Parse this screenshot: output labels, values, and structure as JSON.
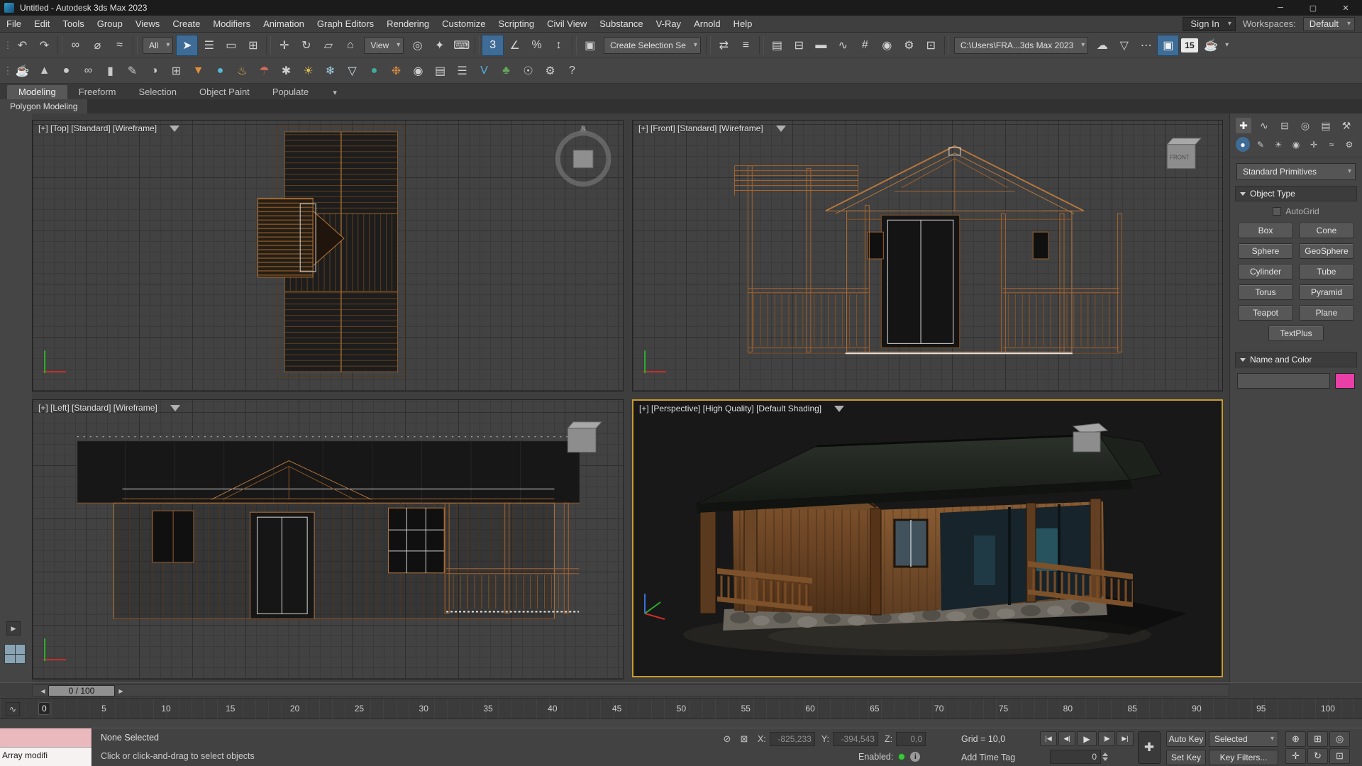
{
  "window": {
    "title": "Untitled - Autodesk 3ds Max 2023",
    "controls": [
      {
        "name": "minimize-button",
        "label": "─"
      },
      {
        "name": "maximize-button",
        "label": "▢"
      },
      {
        "name": "close-button",
        "label": "✕"
      }
    ]
  },
  "menubar": {
    "items": [
      "File",
      "Edit",
      "Tools",
      "Group",
      "Views",
      "Create",
      "Modifiers",
      "Animation",
      "Graph Editors",
      "Rendering",
      "Customize",
      "Scripting",
      "Civil View",
      "Substance",
      "V-Ray",
      "Arnold",
      "Help"
    ],
    "sign_in": "Sign In",
    "workspaces_label": "Workspaces:",
    "workspace_value": "Default"
  },
  "toolbar_main": {
    "items": [
      {
        "name": "toolbar-grip",
        "label": "⋮",
        "cls": "grip"
      },
      {
        "name": "undo-icon",
        "label": "↶"
      },
      {
        "name": "redo-icon",
        "label": "↷"
      },
      {
        "name": "separator",
        "label": "",
        "cls": "sep"
      },
      {
        "name": "select-and-link-icon",
        "label": "∞"
      },
      {
        "name": "unlink-selection-icon",
        "label": "⌀"
      },
      {
        "name": "bind-to-space-warp-icon",
        "label": "≈"
      },
      {
        "name": "separator",
        "label": "",
        "cls": "sep"
      },
      {
        "name": "selection-filter-dropdown",
        "label": "All",
        "cls": "dd"
      },
      {
        "name": "select-object-icon",
        "label": "➤",
        "cls": "active"
      },
      {
        "name": "select-by-name-icon",
        "label": "☰"
      },
      {
        "name": "rectangular-selection-region-icon",
        "label": "▭"
      },
      {
        "name": "window-crossing-icon",
        "label": "⊞"
      },
      {
        "name": "separator",
        "label": "",
        "cls": "sep"
      },
      {
        "name": "select-and-move-icon",
        "label": "✛"
      },
      {
        "name": "select-and-rotate-icon",
        "label": "↻"
      },
      {
        "name": "select-and-scale-icon",
        "label": "▱"
      },
      {
        "name": "select-and-place-icon",
        "label": "⌂"
      },
      {
        "name": "reference-coordinate-dropdown",
        "label": "View",
        "cls": "dd"
      },
      {
        "name": "use-pivot-center-icon",
        "label": "◎"
      },
      {
        "name": "select-and-manipulate-icon",
        "label": "✦"
      },
      {
        "name": "keyboard-shortcut-override-icon",
        "label": "⌨"
      },
      {
        "name": "separator",
        "label": "",
        "cls": "sep"
      },
      {
        "name": "snaps-toggle-icon",
        "label": "3",
        "cls": "active"
      },
      {
        "name": "angle-snap-icon",
        "label": "∠"
      },
      {
        "name": "percent-snap-icon",
        "label": "%"
      },
      {
        "name": "spinner-snap-icon",
        "label": "↕"
      },
      {
        "name": "separator",
        "label": "",
        "cls": "sep"
      },
      {
        "name": "edit-named-selection-sets-icon",
        "label": "▣"
      },
      {
        "name": "named-selection-sets-dropdown",
        "label": "Create Selection Se",
        "cls": "dd"
      },
      {
        "name": "separator",
        "label": "",
        "cls": "sep"
      },
      {
        "name": "mirror-icon",
        "label": "⇄"
      },
      {
        "name": "align-icon",
        "label": "≡"
      },
      {
        "name": "separator",
        "label": "",
        "cls": "sep"
      },
      {
        "name": "toggle-scene-explorer-icon",
        "label": "▤"
      },
      {
        "name": "toggle-layer-explorer-icon",
        "label": "⊟"
      },
      {
        "name": "toggle-ribbon-icon",
        "label": "▬"
      },
      {
        "name": "curve-editor-icon",
        "label": "∿"
      },
      {
        "name": "schematic-view-icon",
        "label": "#"
      },
      {
        "name": "material-editor-icon",
        "label": "◉"
      },
      {
        "name": "render-setup-icon",
        "label": "⚙"
      },
      {
        "name": "rendered-frame-window-icon",
        "label": "⊡"
      },
      {
        "name": "separator",
        "label": "",
        "cls": "sep"
      },
      {
        "name": "project-folder-dropdown",
        "label": "C:\\Users\\FRA...3ds Max 2023",
        "cls": "dd"
      },
      {
        "name": "render-in-cloud-icon",
        "label": "☁"
      },
      {
        "name": "render-presets-icon",
        "label": "▽"
      },
      {
        "name": "batch-render-icon",
        "label": "⋯"
      },
      {
        "name": "active-shade-icon",
        "label": "▣",
        "cls": "active"
      },
      {
        "name": "frame-buffer-size-badge",
        "label": "15",
        "cls": "badge"
      },
      {
        "name": "render-production-icon",
        "label": "☕"
      },
      {
        "name": "render-flyout-icon",
        "label": "▾",
        "cls": "tiny"
      }
    ]
  },
  "toolbar_extra": {
    "items": [
      {
        "name": "toolbar-grip",
        "label": "⋮",
        "cls": "grip"
      },
      {
        "name": "teapot-icon",
        "label": "☕",
        "color": "#c9c9c9"
      },
      {
        "name": "cone-icon",
        "label": "▲",
        "color": "#c9c9c9"
      },
      {
        "name": "sphere-icon",
        "label": "●",
        "color": "#c9c9c9"
      },
      {
        "name": "knot-icon",
        "label": "∞",
        "color": "#c9c9c9"
      },
      {
        "name": "cylinder-icon",
        "label": "▮",
        "color": "#c9c9c9"
      },
      {
        "name": "spline-icon",
        "label": "✎",
        "color": "#c9c9c9"
      },
      {
        "name": "boolean-icon",
        "label": "◑",
        "color": "#c9c9c9"
      },
      {
        "name": "array-icon",
        "label": "⊞",
        "color": "#c9c9c9"
      },
      {
        "name": "funnel-tool-icon",
        "label": "▼",
        "color": "#dd8f3d"
      },
      {
        "name": "droplet-icon",
        "label": "●",
        "color": "#55b7d4"
      },
      {
        "name": "heat-icon",
        "label": "♨",
        "color": "#d9a44b"
      },
      {
        "name": "umbrella-icon",
        "label": "☂",
        "color": "#d4695b"
      },
      {
        "name": "spray-icon",
        "label": "✱",
        "color": "#cfcfcf"
      },
      {
        "name": "sun-icon",
        "label": "☀",
        "color": "#e4bf4a"
      },
      {
        "name": "snowflake-icon",
        "label": "❄",
        "color": "#a3d3e8"
      },
      {
        "name": "glass-icon",
        "label": "▽",
        "color": "#cfe3ea"
      },
      {
        "name": "orb-icon",
        "label": "●",
        "color": "#3fae9a"
      },
      {
        "name": "molecule-icon",
        "label": "❉",
        "color": "#df8f3f"
      },
      {
        "name": "eye-icon",
        "label": "◉",
        "color": "#cfcfcf"
      },
      {
        "name": "sheet-icon",
        "label": "▤",
        "color": "#cfcfcf"
      },
      {
        "name": "chart-icon",
        "label": "☰",
        "color": "#cfcfcf"
      },
      {
        "name": "vray-icon",
        "label": "V",
        "color": "#58aee0"
      },
      {
        "name": "tree-icon",
        "label": "♣",
        "color": "#64a85c"
      },
      {
        "name": "globe-icon",
        "label": "☉",
        "color": "#cfcfcf"
      },
      {
        "name": "settings-icon",
        "label": "⚙",
        "color": "#cfcfcf"
      },
      {
        "name": "help-icon",
        "label": "?",
        "color": "#cfcfcf"
      }
    ]
  },
  "ribbon": {
    "tabs": [
      {
        "label": "Modeling",
        "name": "tab-modeling",
        "cls": "active"
      },
      {
        "label": "Freeform",
        "name": "tab-freeform"
      },
      {
        "label": "Selection",
        "name": "tab-selection"
      },
      {
        "label": "Object Paint",
        "name": "tab-object-paint"
      },
      {
        "label": "Populate",
        "name": "tab-populate"
      }
    ],
    "flyout": "▾",
    "panel_label": "Polygon Modeling"
  },
  "viewports": {
    "top": {
      "label": "[+] [Top] [Standard] [Wireframe]",
      "compass_n": "N"
    },
    "front": {
      "label": "[+] [Front] [Standard] [Wireframe]",
      "cube_label": "FRONT"
    },
    "left": {
      "label": "[+] [Left] [Standard] [Wireframe]"
    },
    "perspective": {
      "label": "[+] [Perspective] [High Quality] [Default Shading]"
    }
  },
  "command_panel": {
    "tabs": [
      {
        "name": "create-tab",
        "label": "✚",
        "cls": "active"
      },
      {
        "name": "modify-tab",
        "label": "∿"
      },
      {
        "name": "hierarchy-tab",
        "label": "⊟"
      },
      {
        "name": "motion-tab",
        "label": "◎"
      },
      {
        "name": "display-tab",
        "label": "▤"
      },
      {
        "name": "utilities-tab",
        "label": "⚒"
      }
    ],
    "subtabs": [
      {
        "name": "geometry-subtab",
        "label": "●",
        "cls": "active"
      },
      {
        "name": "shapes-subtab",
        "label": "✎"
      },
      {
        "name": "lights-subtab",
        "label": "☀"
      },
      {
        "name": "cameras-subtab",
        "label": "◉"
      },
      {
        "name": "helpers-subtab",
        "label": "✛"
      },
      {
        "name": "spacewarps-subtab",
        "label": "≈"
      },
      {
        "name": "systems-subtab",
        "label": "⚙"
      }
    ],
    "category_dropdown": "Standard Primitives",
    "object_type_title": "Object Type",
    "autogrid_label": "AutoGrid",
    "object_buttons": [
      "Box",
      "Cone",
      "Sphere",
      "GeoSphere",
      "Cylinder",
      "Tube",
      "Torus",
      "Pyramid",
      "Teapot",
      "Plane",
      "TextPlus"
    ],
    "name_color_title": "Name and Color",
    "swatch_color": "#e93fa7"
  },
  "timeline": {
    "prev_icon": "◀",
    "slider_label": "0 / 100",
    "next_icon": "▶",
    "curve_toggle_icon": "∿",
    "ticks": [
      {
        "label": "0",
        "cls": "current"
      },
      {
        "label": "5"
      },
      {
        "label": "10"
      },
      {
        "label": "15"
      },
      {
        "label": "20"
      },
      {
        "label": "25"
      },
      {
        "label": "30"
      },
      {
        "label": "35"
      },
      {
        "label": "40"
      },
      {
        "label": "45"
      },
      {
        "label": "50"
      },
      {
        "label": "55"
      },
      {
        "label": "60"
      },
      {
        "label": "65"
      },
      {
        "label": "70"
      },
      {
        "label": "75"
      },
      {
        "label": "80"
      },
      {
        "label": "85"
      },
      {
        "label": "90"
      },
      {
        "label": "95"
      },
      {
        "label": "100"
      }
    ]
  },
  "statusbar": {
    "listener_text": "Array modifi",
    "selection_status": "None Selected",
    "prompt": "Click or click-and-drag to select objects",
    "pre_icons": [
      {
        "name": "isolate-selection-icon",
        "label": "⊘"
      },
      {
        "name": "offset-mode-icon",
        "label": "⊠"
      }
    ],
    "x_label": "X:",
    "x_value": "-825,233",
    "y_label": "Y:",
    "y_value": "-394,543",
    "z_label": "Z:",
    "z_value": "0,0",
    "grid_label": "Grid = 10,0",
    "enabled_label": "Enabled:",
    "info_icon": "i",
    "add_time_tag": "Add Time Tag",
    "playback": [
      {
        "name": "go-to-start-button",
        "label": "|◀"
      },
      {
        "name": "previous-frame-button",
        "label": "◀|"
      },
      {
        "name": "play-button",
        "label": "▶",
        "cls": "play"
      },
      {
        "name": "next-frame-button",
        "label": "|▶"
      },
      {
        "name": "go-to-end-button",
        "label": "▶|"
      }
    ],
    "frame_value": "0",
    "key_mode_icon": "✚",
    "auto_key": "Auto Key",
    "selected_set": "Selected",
    "set_key": "Set Key",
    "key_filters": "Key Filters...",
    "nav": [
      {
        "name": "zoom-icon",
        "label": "⊕"
      },
      {
        "name": "zoom-all-icon",
        "label": "⊞"
      },
      {
        "name": "zoom-extents-icon",
        "label": "◎"
      },
      {
        "name": "pan-icon",
        "label": "✛"
      },
      {
        "name": "orbit-icon",
        "label": "↻"
      },
      {
        "name": "maximize-viewport-icon",
        "label": "⊡"
      }
    ]
  },
  "leftbar": {
    "flyout_icon": "▶"
  }
}
